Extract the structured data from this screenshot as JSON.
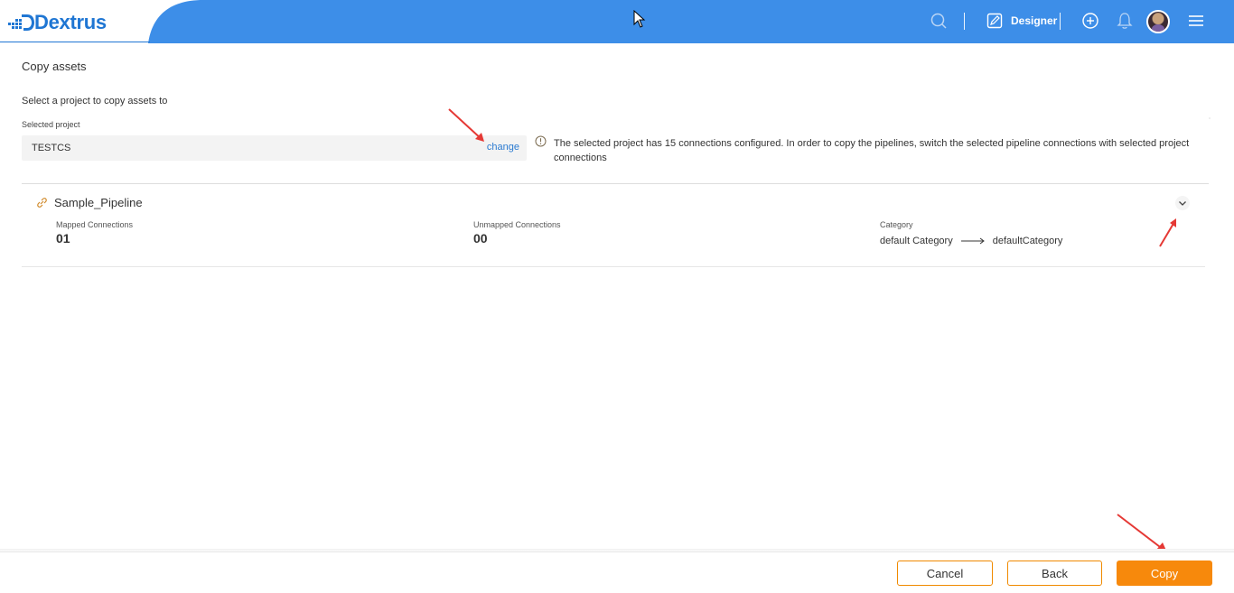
{
  "header": {
    "logo_text": "Dextrus",
    "designer_label": "Designer",
    "icons": [
      "search-icon",
      "edit-icon",
      "plus-circle-icon",
      "bell-icon",
      "avatar",
      "hamburger-icon"
    ],
    "accent_color": "#3d8ee8"
  },
  "page": {
    "title": "Copy assets",
    "select_hint": "Select a project to copy assets to",
    "selected_project_label": "Selected project",
    "selected_project_value": "TESTCS",
    "change_link": "change",
    "info_message": "The selected project has 15 connections configured. In order to copy the pipelines, switch the selected pipeline connections with selected project connections"
  },
  "pipeline": {
    "name": "Sample_Pipeline",
    "mapped_label": "Mapped Connections",
    "mapped_value": "01",
    "unmapped_label": "Unmapped Connections",
    "unmapped_value": "00",
    "category_label": "Category",
    "category_from": "default Category",
    "category_to": "defaultCategory"
  },
  "footer": {
    "cancel_label": "Cancel",
    "back_label": "Back",
    "copy_label": "Copy",
    "button_color": "#f7890c"
  }
}
